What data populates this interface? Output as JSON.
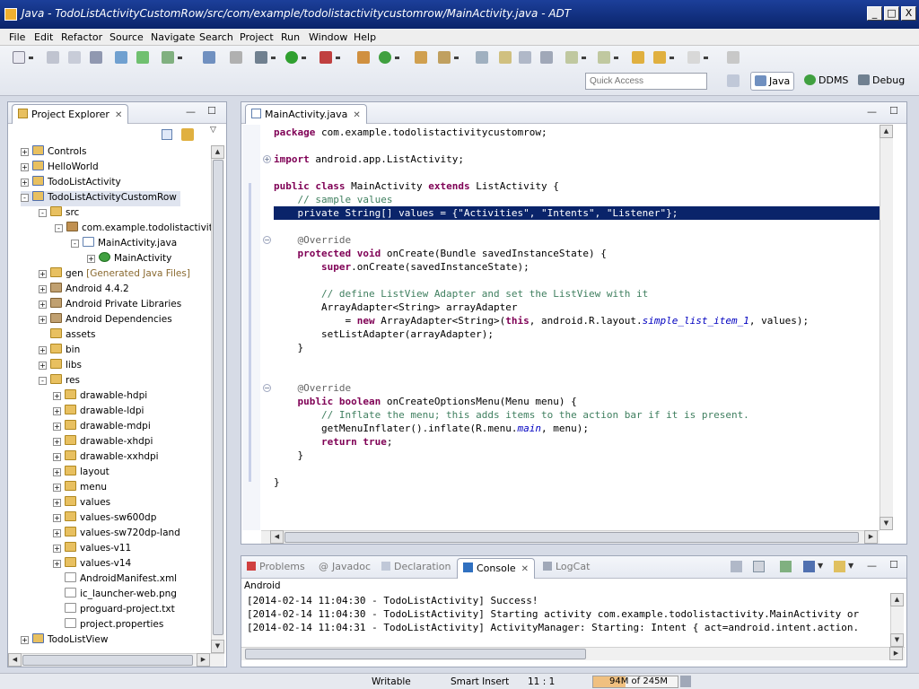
{
  "window": {
    "title": "Java - TodoListActivityCustomRow/src/com/example/todolistactivitycustomrow/MainActivity.java - ADT",
    "buttons": [
      "_",
      "□",
      "X"
    ]
  },
  "menu": [
    "File",
    "Edit",
    "Refactor",
    "Source",
    "Navigate",
    "Search",
    "Project",
    "Run",
    "Window",
    "Help"
  ],
  "toolbar": {
    "quick_access_placeholder": "Quick Access",
    "perspectives": [
      {
        "label": "Java",
        "icon": "java-perspective-icon"
      },
      {
        "label": "DDMS",
        "icon": "ddms-perspective-icon"
      },
      {
        "label": "Debug",
        "icon": "debug-perspective-icon"
      }
    ]
  },
  "project_explorer": {
    "title": "Project Explorer",
    "items": [
      {
        "label": "Controls",
        "expander": "+",
        "icon": "project-icon"
      },
      {
        "label": "HelloWorld",
        "expander": "+",
        "icon": "project-icon"
      },
      {
        "label": "TodoListActivity",
        "expander": "+",
        "icon": "project-icon"
      },
      {
        "label": "TodoListActivityCustomRow",
        "expander": "-",
        "icon": "project-icon"
      },
      {
        "label": "src",
        "expander": "-",
        "icon": "folder-icon"
      },
      {
        "label": "com.example.todolistactivity",
        "expander": "-",
        "icon": "package-icon"
      },
      {
        "label": "MainActivity.java",
        "expander": "-",
        "icon": "java-file-icon"
      },
      {
        "label": "MainActivity",
        "expander": "+",
        "icon": "class-icon"
      },
      {
        "label": "gen",
        "decoration": "[Generated Java Files]",
        "expander": "+",
        "icon": "folder-icon"
      },
      {
        "label": "Android 4.4.2",
        "expander": "+",
        "icon": "library-icon"
      },
      {
        "label": "Android Private Libraries",
        "expander": "+",
        "icon": "library-icon"
      },
      {
        "label": "Android Dependencies",
        "expander": "+",
        "icon": "library-icon"
      },
      {
        "label": "assets",
        "expander": "",
        "icon": "folder-icon"
      },
      {
        "label": "bin",
        "expander": "+",
        "icon": "folder-icon"
      },
      {
        "label": "libs",
        "expander": "+",
        "icon": "folder-icon"
      },
      {
        "label": "res",
        "expander": "-",
        "icon": "folder-icon"
      },
      {
        "label": "drawable-hdpi",
        "expander": "+",
        "icon": "folder-icon"
      },
      {
        "label": "drawable-ldpi",
        "expander": "+",
        "icon": "folder-icon"
      },
      {
        "label": "drawable-mdpi",
        "expander": "+",
        "icon": "folder-icon"
      },
      {
        "label": "drawable-xhdpi",
        "expander": "+",
        "icon": "folder-icon"
      },
      {
        "label": "drawable-xxhdpi",
        "expander": "+",
        "icon": "folder-icon"
      },
      {
        "label": "layout",
        "expander": "+",
        "icon": "folder-icon"
      },
      {
        "label": "menu",
        "expander": "+",
        "icon": "folder-icon"
      },
      {
        "label": "values",
        "expander": "+",
        "icon": "folder-icon"
      },
      {
        "label": "values-sw600dp",
        "expander": "+",
        "icon": "folder-icon"
      },
      {
        "label": "values-sw720dp-land",
        "expander": "+",
        "icon": "folder-icon"
      },
      {
        "label": "values-v11",
        "expander": "+",
        "icon": "folder-icon"
      },
      {
        "label": "values-v14",
        "expander": "+",
        "icon": "folder-icon"
      },
      {
        "label": "AndroidManifest.xml",
        "expander": "",
        "icon": "xml-file-icon"
      },
      {
        "label": "ic_launcher-web.png",
        "expander": "",
        "icon": "image-file-icon"
      },
      {
        "label": "proguard-project.txt",
        "expander": "",
        "icon": "text-file-icon"
      },
      {
        "label": "project.properties",
        "expander": "",
        "icon": "properties-file-icon"
      },
      {
        "label": "TodoListView",
        "expander": "+",
        "icon": "project-icon"
      }
    ]
  },
  "editor": {
    "tab": "MainActivity.java",
    "lines": [
      "package com.example.todolistactivitycustomrow;",
      "",
      "import android.app.ListActivity;",
      "",
      "public class MainActivity extends ListActivity {",
      "    // sample values",
      "    private String[] values = {\"Activities\", \"Intents\", \"Listener\"};",
      "",
      "    @Override",
      "    protected void onCreate(Bundle savedInstanceState) {",
      "        super.onCreate(savedInstanceState);",
      "",
      "        // define ListView Adapter and set the ListView with it",
      "        ArrayAdapter<String> arrayAdapter",
      "            = new ArrayAdapter<String>(this, android.R.layout.simple_list_item_1, values);",
      "        setListAdapter(arrayAdapter);",
      "    }",
      "",
      "",
      "    @Override",
      "    public boolean onCreateOptionsMenu(Menu menu) {",
      "        // Inflate the menu; this adds items to the action bar if it is present.",
      "        getMenuInflater().inflate(R.menu.main, menu);",
      "        return true;",
      "    }",
      "",
      "}"
    ],
    "highlighted_line": 7
  },
  "bottom": {
    "tabs": [
      "Problems",
      "Javadoc",
      "Declaration",
      "Console",
      "LogCat"
    ],
    "active_tab": "Console",
    "console_title": "Android",
    "lines": [
      "[2014-02-14 11:04:30 - TodoListActivity] Success!",
      "[2014-02-14 11:04:30 - TodoListActivity] Starting activity com.example.todolistactivity.MainActivity or",
      "[2014-02-14 11:04:31 - TodoListActivity] ActivityManager: Starting: Intent { act=android.intent.action."
    ]
  },
  "status": {
    "writable": "Writable",
    "insert_mode": "Smart Insert",
    "position": "11 : 1",
    "heap": "94M of 245M",
    "heap_fraction": 0.38
  }
}
